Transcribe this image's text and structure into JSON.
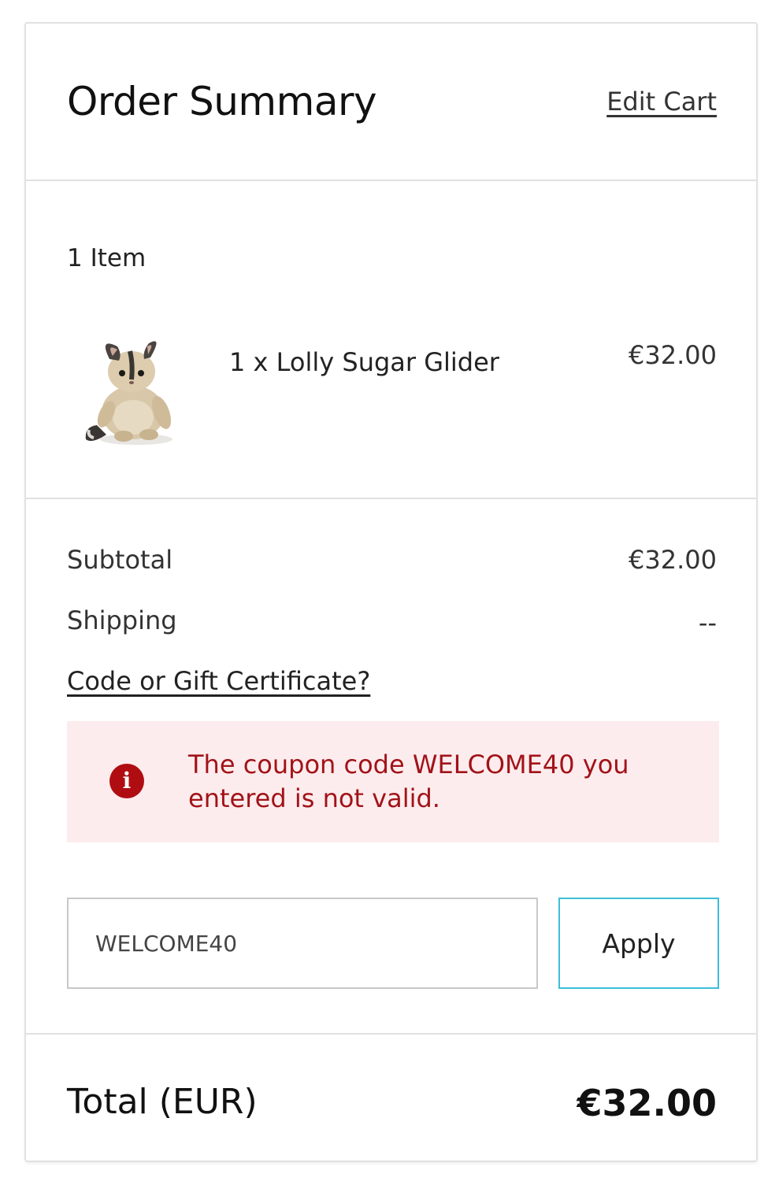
{
  "header": {
    "title": "Order Summary",
    "edit_cart_label": "Edit Cart"
  },
  "items": {
    "count_label": "1 Item",
    "list": [
      {
        "name": "1 x Lolly Sugar Glider",
        "price": "€32.00",
        "image": "plush-sugar-glider-thumbnail"
      }
    ]
  },
  "totals": {
    "subtotal_label": "Subtotal",
    "subtotal_value": "€32.00",
    "shipping_label": "Shipping",
    "shipping_value": "--"
  },
  "coupon": {
    "toggle_label": "Code or Gift Certificate?",
    "error_icon": "info-circle-icon",
    "error_message": "The coupon code WELCOME40 you entered is not valid.",
    "input_value": "WELCOME40",
    "apply_label": "Apply"
  },
  "grand_total": {
    "label": "Total (EUR)",
    "value": "€32.00"
  },
  "colors": {
    "error_bg": "#fdeced",
    "error_text": "#a11319",
    "error_icon": "#b00d12",
    "apply_border": "#3cbfd8",
    "border": "#e1e1e1"
  }
}
